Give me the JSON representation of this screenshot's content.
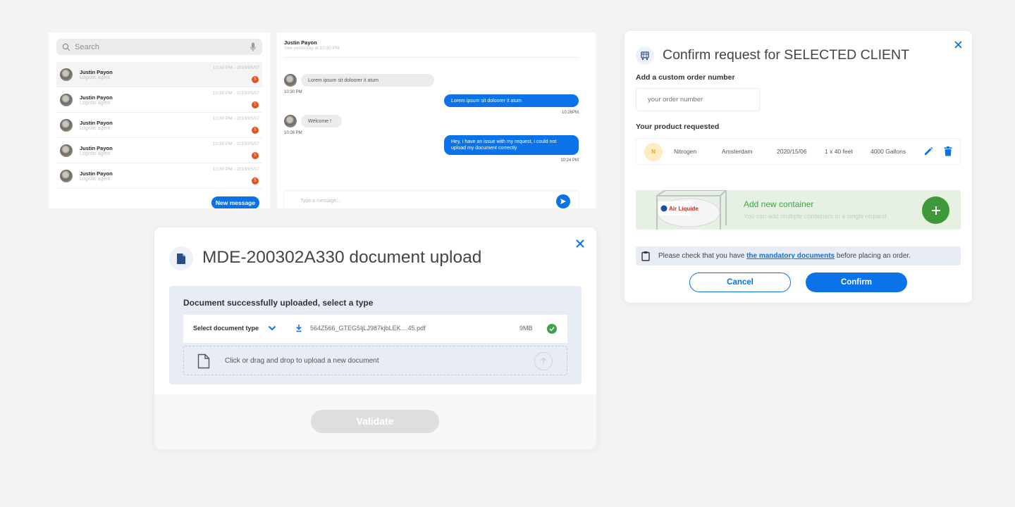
{
  "contacts": {
    "search_placeholder": "Search",
    "items": [
      {
        "name": "Justin Payon",
        "role": "Logistic agent",
        "time": "10:30 PM - 2019/05/07",
        "badge": "5"
      },
      {
        "name": "Justin Payon",
        "role": "Logistic agent",
        "time": "10:30 PM - 2019/05/07",
        "badge": "5"
      },
      {
        "name": "Justin Payon",
        "role": "Logistic agent",
        "time": "10:30 PM - 2019/05/07",
        "badge": "5"
      },
      {
        "name": "Justin Payon",
        "role": "Logistic agent",
        "time": "10:30 PM - 2019/05/07",
        "badge": "5"
      },
      {
        "name": "Justin Payon",
        "role": "Logistic agent",
        "time": "10:30 PM - 2019/05/07",
        "badge": "5"
      }
    ],
    "new_message_label": "New message"
  },
  "chat": {
    "contact_name": "Justin Payon",
    "seen": "See yesterday at 10:30 PM",
    "messages": [
      {
        "text": "Lorem ipsum sit doloorer it atum",
        "time": "10:30 PM"
      },
      {
        "text": "Lorem ipsum sit doloorer it atum",
        "time": "10:26PM"
      },
      {
        "text": "Welcome !",
        "time": "10:26 PM"
      },
      {
        "line1": "Hey, i have an issue with my request, i could not",
        "line2": "upload my document correctly",
        "time": "10:24 PM"
      }
    ],
    "input_placeholder": "Type a message..."
  },
  "upload": {
    "title": "MDE-200302A330 document upload",
    "success_text": "Document successfully uploaded, select a type",
    "doc_type_label": "Select document type",
    "file_name": "564Z566_GTEG5IjLJ987kjbLEK....45.pdf",
    "file_size": "9MB",
    "drop_text": "Click or drag and drop to upload a new document",
    "validate_label": "Validate"
  },
  "confirm": {
    "title": "Confirm request for SELECTED CLIENT",
    "order_label": "Add a custom order number",
    "order_placeholder": "your order number",
    "product_label": "Your product requested",
    "product": {
      "initial": "N",
      "name": "Nitrogen",
      "location": "Amsterdam",
      "date": "2020/15/06",
      "container": "1 x 40 feet",
      "volume": "4000 Gallons"
    },
    "add_title": "Add new container",
    "add_sub": "You can add multiple containers in a single request",
    "tank_brand": "Air Liquide",
    "notice_before": "Please check that you have ",
    "notice_link": "the mandatory documents",
    "notice_after": " before placing an order.",
    "cancel_label": "Cancel",
    "confirm_label": "Confirm"
  },
  "colors": {
    "accent": "#0b72e7",
    "success": "#3ea34a",
    "badge": "#e0521f",
    "product_badge": "#fdedc4"
  }
}
